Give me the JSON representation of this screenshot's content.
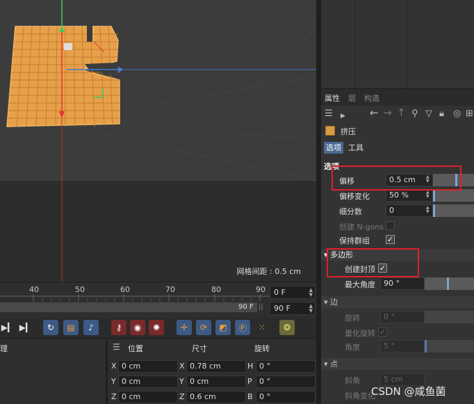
{
  "viewport": {
    "grid_spacing_label": "网格间距 : 0.5 cm"
  },
  "timeline": {
    "ticks": [
      "40",
      "50",
      "60",
      "70",
      "80",
      "90"
    ],
    "frame_start": "0 F",
    "frame_end": "90 F",
    "range_end_label": "90 F",
    "range_pipes": "||"
  },
  "coords": {
    "left_label": "理",
    "headers": {
      "position": "位置",
      "size": "尺寸",
      "rotation": "旋转"
    },
    "rows": [
      {
        "p_axis": "X",
        "p_val": "0 cm",
        "s_axis": "X",
        "s_val": "0.78 cm",
        "r_axis": "H",
        "r_val": "0 °"
      },
      {
        "p_axis": "Y",
        "p_val": "0 cm",
        "s_axis": "Y",
        "s_val": "0 cm",
        "r_axis": "P",
        "r_val": "0 °"
      },
      {
        "p_axis": "Z",
        "p_val": "0 cm",
        "s_axis": "Z",
        "s_val": "0.6 cm",
        "r_axis": "B",
        "r_val": "0 °"
      }
    ]
  },
  "attributes": {
    "tabs": [
      "属性",
      "层",
      "构造"
    ],
    "object_name": "挤压",
    "sub_tabs": [
      "选项",
      "工具"
    ],
    "section_options": "选项",
    "props": {
      "offset_label": "偏移",
      "offset_value": "0.5 cm",
      "offset_var_label": "偏移变化",
      "offset_var_value": "50 %",
      "subdiv_label": "细分数",
      "subdiv_value": "0",
      "ngons_label": "创建 N-gons",
      "preserve_groups_label": "保持群组"
    },
    "group_polygon": "多边形",
    "create_caps_label": "创建封顶",
    "max_angle_label": "最大角度",
    "max_angle_value": "90 °",
    "group_edge": "边",
    "edge_rotate_label": "旋转",
    "edge_rotate_value": "0 °",
    "edge_quantize_label": "量化旋转",
    "edge_angle_label": "角度",
    "edge_angle_value": "5 °",
    "group_point": "点",
    "bevel_label": "斜角",
    "bevel_value": "5 cm",
    "bevel_var_label": "斜角变化"
  },
  "colors": {
    "highlight_box": "#e0202a",
    "mesh_orange": "#e7a04a",
    "active_tab_blue": "#4b6a93"
  },
  "watermark": "CSDN @咸鱼菌"
}
